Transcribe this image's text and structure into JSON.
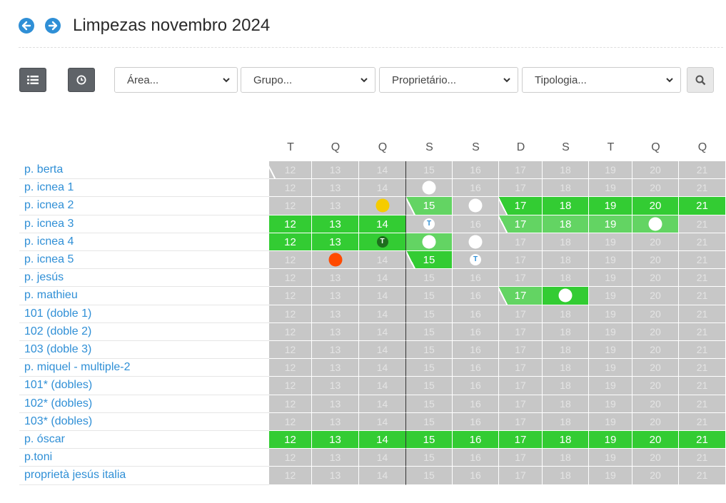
{
  "header": {
    "title": "Limpezas novembro 2024",
    "prev_icon": "arrow-left-icon",
    "next_icon": "arrow-right-icon"
  },
  "toolbar": {
    "list_icon": "list-icon",
    "clock_icon": "clock-icon",
    "filters": [
      {
        "placeholder": "Área..."
      },
      {
        "placeholder": "Grupo..."
      },
      {
        "placeholder": "Proprietário..."
      },
      {
        "placeholder": "Tipologia..."
      }
    ],
    "search_icon": "search-icon"
  },
  "colors": {
    "occupied": "#33cc33",
    "occupied_light": "#63d463",
    "free": "#c7c7c7",
    "link": "#2f8fd6",
    "yellow": "#f5cc00",
    "red": "#ff4a00",
    "dark_green": "#1e6e1e"
  },
  "days": [
    {
      "letter": "T",
      "num": "12"
    },
    {
      "letter": "Q",
      "num": "13"
    },
    {
      "letter": "Q",
      "num": "14"
    },
    {
      "letter": "S",
      "num": "15"
    },
    {
      "letter": "S",
      "num": "16"
    },
    {
      "letter": "D",
      "num": "17"
    },
    {
      "letter": "S",
      "num": "18"
    },
    {
      "letter": "T",
      "num": "19"
    },
    {
      "letter": "Q",
      "num": "20"
    },
    {
      "letter": "Q",
      "num": "21"
    }
  ],
  "rows": [
    {
      "name": "p. berta",
      "cells": [
        "fs",
        "f",
        "f",
        "f",
        "f",
        "f",
        "f",
        "f",
        "f",
        "f"
      ]
    },
    {
      "name": "p. icnea 1",
      "cells": [
        "f",
        "f",
        "f",
        "fw",
        "f",
        "f",
        "f",
        "f",
        "f",
        "f"
      ]
    },
    {
      "name": "p. icnea 2",
      "cells": [
        "f",
        "f",
        "fy",
        "ls",
        "fw",
        "ss",
        "o",
        "o",
        "o",
        "o"
      ]
    },
    {
      "name": "p. icnea 3",
      "cells": [
        "o",
        "o",
        "o",
        "ft",
        "f",
        "ls",
        "l",
        "l",
        "lw",
        "f"
      ]
    },
    {
      "name": "p. icnea 4",
      "cells": [
        "o",
        "o",
        "od",
        "lw",
        "fw",
        "f",
        "f",
        "f",
        "f",
        "f"
      ]
    },
    {
      "name": "p. icnea 5",
      "cells": [
        "f",
        "fr",
        "f",
        "ss",
        "ft",
        "f",
        "f",
        "f",
        "f",
        "f"
      ]
    },
    {
      "name": "p. jesús",
      "cells": [
        "f",
        "f",
        "f",
        "f",
        "f",
        "f",
        "f",
        "f",
        "f",
        "f"
      ]
    },
    {
      "name": "p. mathieu",
      "cells": [
        "f",
        "f",
        "f",
        "f",
        "f",
        "ls",
        "ow",
        "f",
        "f",
        "f"
      ]
    },
    {
      "name": "101 (doble 1)",
      "cells": [
        "f",
        "f",
        "f",
        "f",
        "f",
        "f",
        "f",
        "f",
        "f",
        "f"
      ]
    },
    {
      "name": "102 (doble 2)",
      "cells": [
        "f",
        "f",
        "f",
        "f",
        "f",
        "f",
        "f",
        "f",
        "f",
        "f"
      ]
    },
    {
      "name": "103 (doble 3)",
      "cells": [
        "f",
        "f",
        "f",
        "f",
        "f",
        "f",
        "f",
        "f",
        "f",
        "f"
      ]
    },
    {
      "name": "p. miquel - multiple-2",
      "cells": [
        "f",
        "f",
        "f",
        "f",
        "f",
        "f",
        "f",
        "f",
        "f",
        "f"
      ]
    },
    {
      "name": "101* (dobles)",
      "cells": [
        "f",
        "f",
        "f",
        "f",
        "f",
        "f",
        "f",
        "f",
        "f",
        "f"
      ]
    },
    {
      "name": "102* (dobles)",
      "cells": [
        "f",
        "f",
        "f",
        "f",
        "f",
        "f",
        "f",
        "f",
        "f",
        "f"
      ]
    },
    {
      "name": "103* (dobles)",
      "cells": [
        "f",
        "f",
        "f",
        "f",
        "f",
        "f",
        "f",
        "f",
        "f",
        "f"
      ]
    },
    {
      "name": "p. óscar",
      "cells": [
        "o",
        "o",
        "o",
        "o",
        "o",
        "o",
        "o",
        "o",
        "o",
        "o"
      ]
    },
    {
      "name": "p.toni",
      "cells": [
        "f",
        "f",
        "f",
        "f",
        "f",
        "f",
        "f",
        "f",
        "f",
        "f"
      ]
    },
    {
      "name": "proprietà jesús italia",
      "cells": [
        "f",
        "f",
        "f",
        "f",
        "f",
        "f",
        "f",
        "f",
        "f",
        "f"
      ]
    }
  ],
  "badge_letter": "T"
}
